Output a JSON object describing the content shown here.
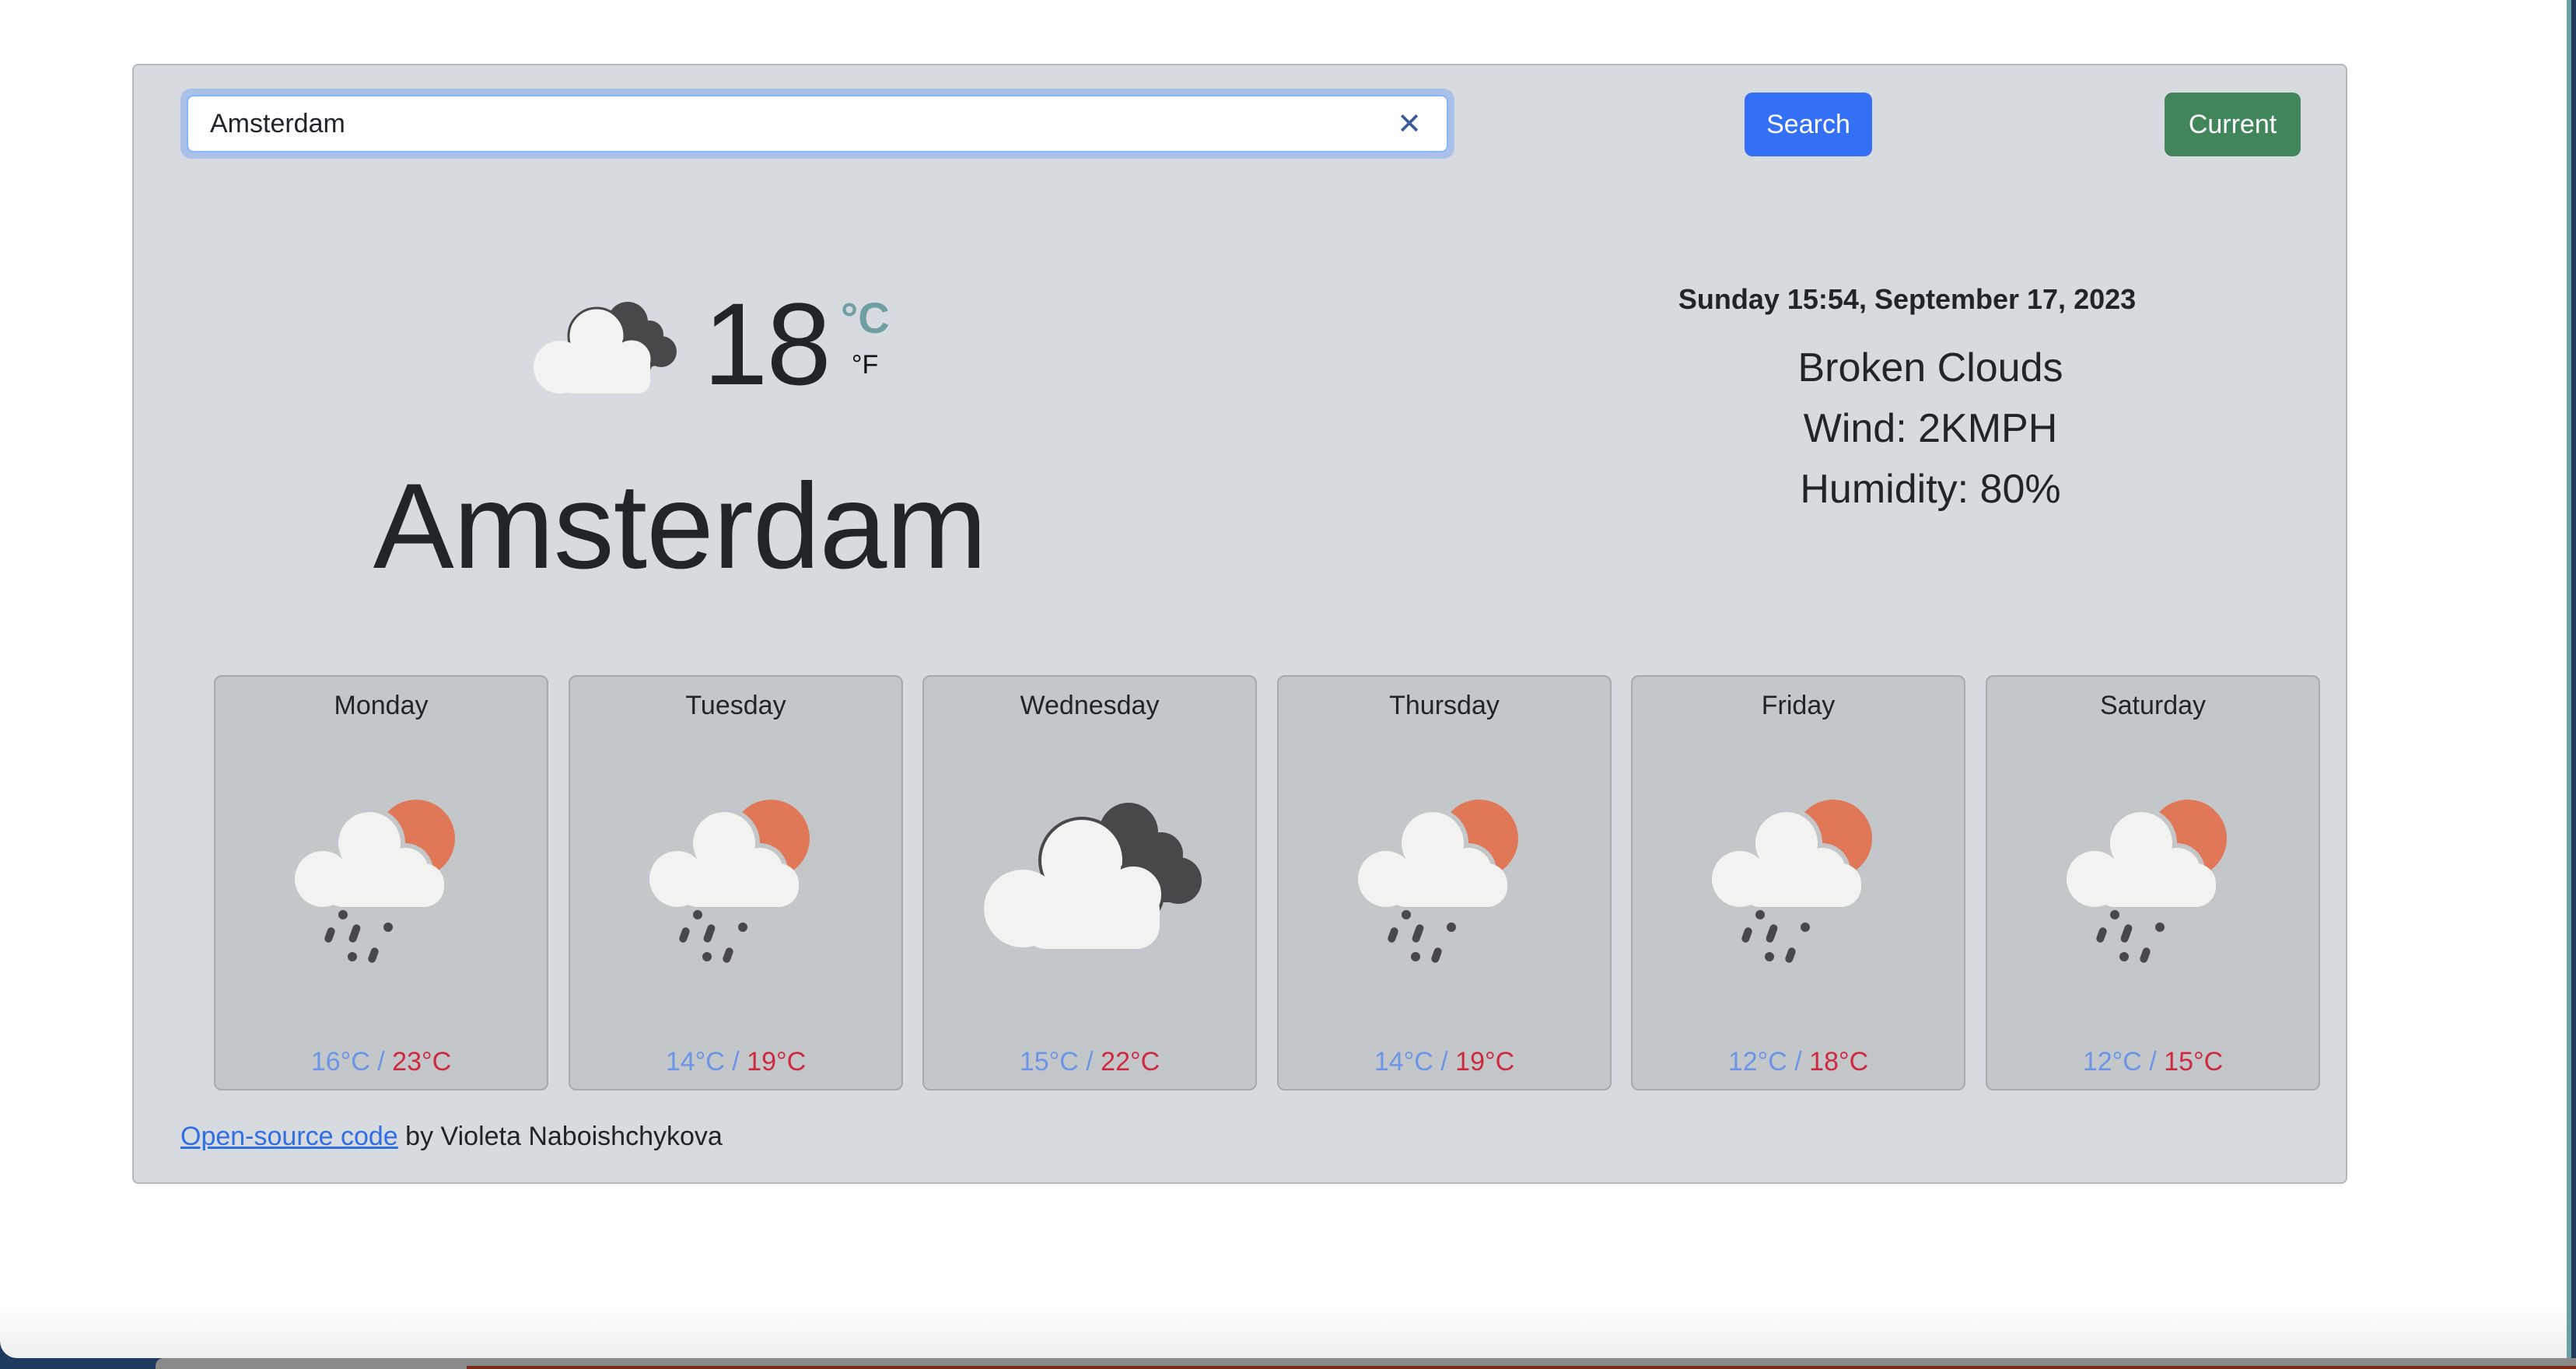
{
  "search": {
    "value": "Amsterdam",
    "clear_icon": "close-icon",
    "search_label": "Search",
    "current_label": "Current"
  },
  "current": {
    "icon": "broken-clouds-icon",
    "temperature": "18",
    "unit_celsius": "°C",
    "unit_fahrenheit": "°F",
    "city": "Amsterdam",
    "datetime": "Sunday 15:54, September 17, 2023",
    "description": "Broken Clouds",
    "wind": "Wind: 2KMPH",
    "humidity": "Humidity: 80%"
  },
  "forecast": [
    {
      "day": "Monday",
      "icon": "rain-sun-icon",
      "min": "16°C",
      "max": "23°C"
    },
    {
      "day": "Tuesday",
      "icon": "rain-sun-icon",
      "min": "14°C",
      "max": "19°C"
    },
    {
      "day": "Wednesday",
      "icon": "broken-clouds-icon",
      "min": "15°C",
      "max": "22°C"
    },
    {
      "day": "Thursday",
      "icon": "rain-sun-icon",
      "min": "14°C",
      "max": "19°C"
    },
    {
      "day": "Friday",
      "icon": "rain-sun-icon",
      "min": "12°C",
      "max": "18°C"
    },
    {
      "day": "Saturday",
      "icon": "rain-sun-icon",
      "min": "12°C",
      "max": "15°C"
    }
  ],
  "forecast_separator": " / ",
  "footer": {
    "link_text": "Open-source code",
    "author_text": " by Violeta Naboishchykova"
  },
  "colors": {
    "accent_search": "#3370f5",
    "accent_current": "#41865a",
    "min_temp": "#6b95e8",
    "max_temp": "#d0293f",
    "unit_active": "#6f9fa0"
  }
}
